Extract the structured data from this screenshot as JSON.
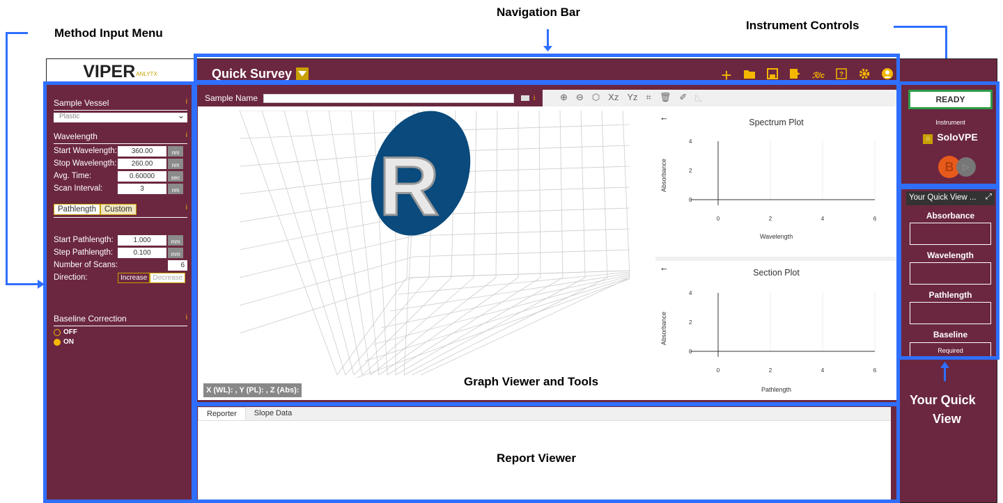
{
  "callouts": {
    "navigation_bar": "Navigation Bar",
    "method_input_menu": "Method Input Menu",
    "instrument_controls": "Instrument Controls",
    "graph_viewer": "Graph Viewer and Tools",
    "report_viewer": "Report Viewer",
    "your_quick_view_1": "Your Quick",
    "your_quick_view_2": "View"
  },
  "logo": {
    "main": "VIPER",
    "sub": "ANLYTX"
  },
  "nav": {
    "title": "Quick Survey",
    "icons": [
      "plus-icon",
      "folder-icon",
      "save-icon",
      "export-icon",
      "method-icon",
      "help-icon",
      "gear-icon",
      "user-icon"
    ]
  },
  "method": {
    "sample_vessel": {
      "heading": "Sample Vessel",
      "value": "Plastic"
    },
    "wavelength": {
      "heading": "Wavelength",
      "start_label": "Start Wavelength:",
      "start_value": "360.00",
      "start_unit": "nm",
      "stop_label": "Stop Wavelength:",
      "stop_value": "260.00",
      "stop_unit": "nm",
      "avg_label": "Avg. Time:",
      "avg_value": "0.60000",
      "avg_unit": "sec",
      "interval_label": "Scan Interval:",
      "interval_value": "3",
      "interval_unit": "nm"
    },
    "pathlength": {
      "tab_pathlength": "Pathlength",
      "tab_custom": "Custom",
      "start_label": "Start Pathlength:",
      "start_value": "1.000",
      "start_unit": "mm",
      "step_label": "Step Pathlength:",
      "step_value": "0.100",
      "step_unit": "mm",
      "scans_label": "Number of Scans:",
      "scans_value": "6",
      "direction_label": "Direction:",
      "increase": "Increase",
      "decrease": "Decrease"
    },
    "baseline": {
      "heading": "Baseline Correction",
      "off": "OFF",
      "on": "ON"
    },
    "info": "i"
  },
  "sample": {
    "label": "Sample Name",
    "value": ""
  },
  "tools": [
    "zoom-in-icon",
    "zoom-out-icon",
    "cube-icon",
    "xz-icon",
    "yz-icon",
    "tag-icon",
    "trash-icon",
    "eraser-icon",
    "chart-icon"
  ],
  "tools_text": {
    "xz": "Xz",
    "yz": "Yz"
  },
  "graph3d": {
    "coords": "X (WL): , Y (PL): , Z (Abs):",
    "letter": "R"
  },
  "spectrum_plot": {
    "title": "Spectrum Plot",
    "xlabel": "Wavelength",
    "ylabel": "Absorbance",
    "xticks": [
      "0",
      "2",
      "4",
      "6"
    ],
    "yticks": [
      "4",
      "2",
      "0"
    ]
  },
  "section_plot": {
    "title": "Section Plot",
    "xlabel": "Pathlength",
    "ylabel": "Absorbance",
    "xticks": [
      "0",
      "2",
      "4",
      "6"
    ],
    "yticks": [
      "4",
      "2",
      "0"
    ]
  },
  "back_arrow": "←",
  "report": {
    "tabs": [
      "Reporter",
      "Slope Data"
    ]
  },
  "instrument": {
    "status": "READY",
    "label": "Instrument",
    "name": "SoloVPE",
    "b": "B"
  },
  "quick_view": {
    "title": "Your Quick View ...",
    "absorbance": "Absorbance",
    "wavelength": "Wavelength",
    "pathlength": "Pathlength",
    "baseline": "Baseline",
    "baseline_value": "Required"
  }
}
